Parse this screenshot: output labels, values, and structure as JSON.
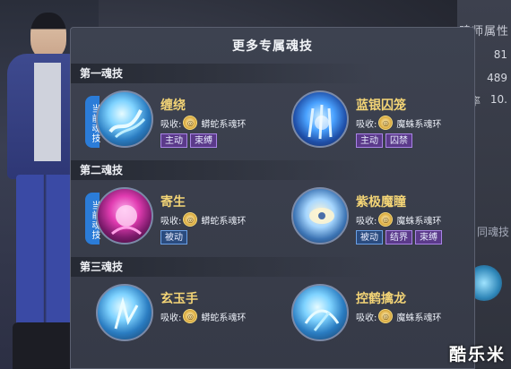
{
  "panel": {
    "title": "更多专属魂技"
  },
  "current_tag": "当前魂技",
  "absorb_label": "吸收:",
  "sections": [
    {
      "header": "第一魂技",
      "skills": [
        {
          "name": "缠绕",
          "ring": "蟒蛇系魂环",
          "icon": "vine-skill-icon",
          "tags": [
            "主动",
            "束缚"
          ]
        },
        {
          "name": "蓝银囚笼",
          "ring": "魔蛛系魂环",
          "icon": "blue-cage-skill-icon",
          "tags": [
            "主动",
            "囚禁"
          ]
        }
      ]
    },
    {
      "header": "第二魂技",
      "skills": [
        {
          "name": "寄生",
          "ring": "蟒蛇系魂环",
          "icon": "parasite-skill-icon",
          "tags": [
            "被动"
          ]
        },
        {
          "name": "紫极魔瞳",
          "ring": "魔蛛系魂环",
          "icon": "purple-eye-skill-icon",
          "tags": [
            "被动",
            "结界",
            "束缚"
          ]
        }
      ]
    },
    {
      "header": "第三魂技",
      "skills": [
        {
          "name": "玄玉手",
          "ring": "蟒蛇系魂环",
          "icon": "jade-hand-skill-icon",
          "tags": []
        },
        {
          "name": "控鹤擒龙",
          "ring": "魔蛛系魂环",
          "icon": "crane-dragon-skill-icon",
          "tags": []
        }
      ]
    }
  ],
  "side": {
    "attr_title": "魂师属性",
    "stats": [
      "81",
      "489",
      "10."
    ],
    "stat_label": "率",
    "link": "同魂技"
  },
  "watermark": "酷乐米",
  "colors": {
    "skill_name": "#f3d476",
    "current_tag": "#2b7cd8",
    "panel_bg": "#3a3e4b"
  }
}
